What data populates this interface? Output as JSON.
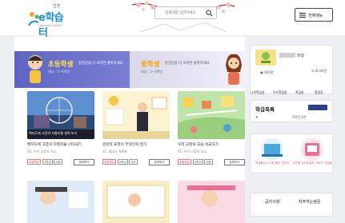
{
  "header": {
    "logo_small": "인천",
    "logo_main": "e학습터",
    "logo_sub": "Learning System",
    "search_placeholder": "검색어를 입력하세요",
    "menu_label": "전체메뉴"
  },
  "banner": {
    "left_title": "초등학생",
    "left_desc": "동영상을 더 보려면 클릭하세요.",
    "left_sub": "대상 : 1~6학년",
    "right_title": "중학생",
    "right_desc": "동영상을 더 보려면 클릭하세요.",
    "right_sub": "대상 : 1~3학년"
  },
  "cards": [
    {
      "title": "백지도에 고장의 지형지물 나타내기",
      "meta": "03. 우리 고장의 모습",
      "tags": [
        "초등학교",
        "3학년",
        "사회"
      ],
      "button": "강좌보기"
    },
    {
      "title": "감각적 표현이 무엇인지 알기",
      "meta": "01. 재미가 톡톡톡",
      "tags": [
        "초등학교",
        "3학년",
        "국어"
      ],
      "button": "강좌보기"
    },
    {
      "title": "우리 고장의 모습 비교하기",
      "meta": "01. 우리 고장의 모습",
      "tags": [
        "초등학교",
        "3학년",
        "사회"
      ],
      "button": "강좌보기"
    }
  ],
  "thumb_caption": "백지도에 고장의 지형지물 살펴 보기",
  "sidebar": {
    "name_suffix": "학생",
    "stat": "▣ 365편",
    "logout": "⊖ 로그아웃",
    "quick": [
      "나의학습방",
      "우리학급방",
      "학급방",
      "알림장"
    ],
    "schedule_title": "학급목록",
    "schedule_row_left": "초",
    "schedule_row_right": "3학년 2반",
    "promo_left": "학생들이 스스로 배운 온라인",
    "promo_right": "온드림 우리미술의 이야기 디딤돌",
    "notice_tabs": [
      "공지사항",
      "자주하는질문"
    ]
  },
  "colors": {
    "brand": "#1f8fd6",
    "banner": "#6b70c9",
    "accent": "#ffe35a",
    "nav": "#2c3e8c"
  }
}
